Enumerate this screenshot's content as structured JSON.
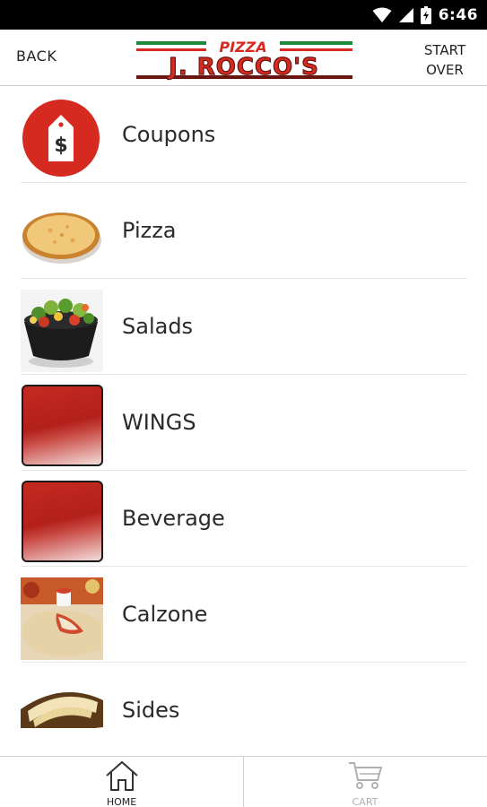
{
  "status_bar": {
    "time": "6:46",
    "icons": [
      "wifi-icon",
      "signal-icon",
      "battery-charging-icon"
    ]
  },
  "header": {
    "back_label": "BACK",
    "logo": {
      "top_text": "PIZZA",
      "main_text": "J. ROCCO'S",
      "colors": {
        "red": "#d62a20",
        "green": "#1f8a3b",
        "maroon": "#6a1410"
      }
    },
    "start_over_line1": "START",
    "start_over_line2": "OVER"
  },
  "menu": {
    "items": [
      {
        "label": "Coupons",
        "icon": "coupon-tag-icon"
      },
      {
        "label": "Pizza",
        "icon": "pizza-photo"
      },
      {
        "label": "Salads",
        "icon": "salad-photo"
      },
      {
        "label": "WINGS",
        "icon": "red-placeholder-tile"
      },
      {
        "label": "Beverage",
        "icon": "red-placeholder-tile"
      },
      {
        "label": "Calzone",
        "icon": "calzone-photo"
      },
      {
        "label": "Sides",
        "icon": "sides-photo"
      }
    ]
  },
  "tab_bar": {
    "home_label": "HOME",
    "cart_label": "CART"
  },
  "colors": {
    "accent_red": "#d62a20",
    "tile_red": "#b3201a",
    "divider": "#e6e6e6",
    "inactive_tab": "#b0b0b0"
  }
}
